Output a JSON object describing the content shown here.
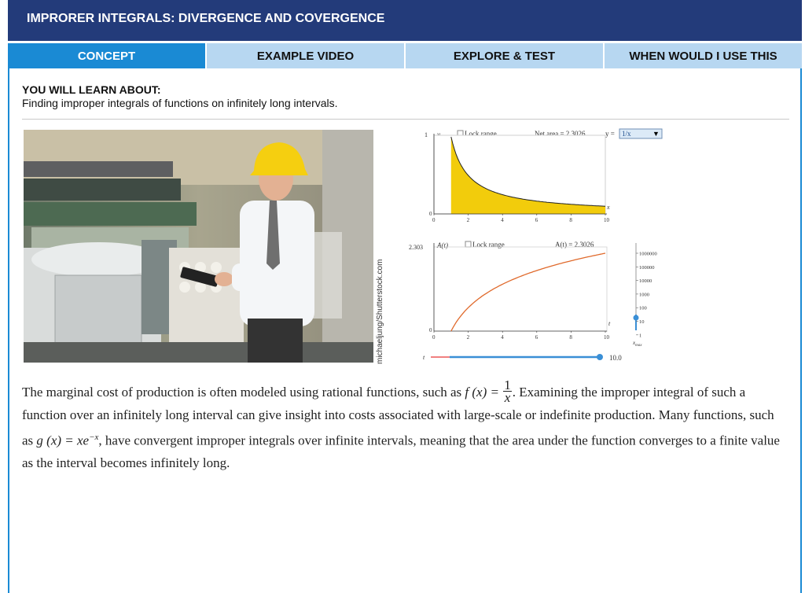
{
  "header": {
    "title": "IMPRORER INTEGRALS: DIVERGENCE AND COVERGENCE"
  },
  "tabs": [
    {
      "label": "CONCEPT",
      "active": true
    },
    {
      "label": "EXAMPLE VIDEO",
      "active": false
    },
    {
      "label": "EXPLORE & TEST",
      "active": false
    },
    {
      "label": "WHEN WOULD I USE THIS",
      "active": false
    }
  ],
  "learn": {
    "heading": "YOU WILL LEARN ABOUT:",
    "text": "Finding improper integrals of functions on infinitely long intervals."
  },
  "photo": {
    "credit": "michaeljung/Shutterstock.com"
  },
  "graph_top": {
    "y_label": "y",
    "lock_label": "Lock range",
    "net_area": "Net area = 2.3026",
    "function_label": "y = ",
    "function_value": "1/x",
    "y_max_tick": "1",
    "y_min_tick": "0",
    "x_label": "x",
    "x_ticks": [
      "0",
      "2",
      "4",
      "6",
      "8",
      "10"
    ]
  },
  "graph_bottom": {
    "y_label": "A(t)",
    "y_max_tick": "2.303",
    "y_min_tick": "0",
    "lock_label": "Lock range",
    "area_label": "A(t) = 2.3026",
    "x_label": "t",
    "x_ticks": [
      "0",
      "2",
      "4",
      "6",
      "8",
      "10"
    ],
    "xmax_scale": [
      "1000000",
      "100000",
      "10000",
      "1000",
      "100",
      "10",
      "1"
    ],
    "xmax_label": "x",
    "xmax_sub": "max",
    "slider_label": "t",
    "slider_value": "10.0"
  },
  "paragraph": {
    "p1": "The marginal cost of production is often modeled using rational functions, such as ",
    "fx": "f (x) = ",
    "num": "1",
    "den": "x",
    "p2": ". Examining the improper integral of such a function over an infinitely long interval can give insight into costs associated with large-scale or indefinite production. Many functions, such as ",
    "gx": "g (x) = xe",
    "exp": "−x",
    "p3": ", have convergent improper integrals over infinite intervals, meaning that the area under the function converges to a finite value as the interval becomes infinitely long."
  },
  "colors": {
    "title_bg": "#233b7a",
    "tab_active": "#1a8ad4",
    "tab_inactive": "#b7d7f1",
    "area_fill": "#f2cc0c",
    "curve": "#e06a2c"
  }
}
